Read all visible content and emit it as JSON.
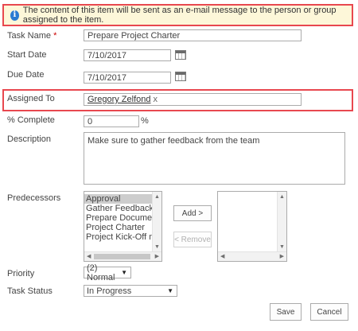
{
  "notice": {
    "text": "The content of this item will be sent as an e-mail message to the person or group assigned to the item.",
    "icon": "i"
  },
  "fields": {
    "task_name": {
      "label": "Task Name",
      "required_mark": "*",
      "value": "Prepare Project Charter"
    },
    "start_date": {
      "label": "Start Date",
      "value": "7/10/2017"
    },
    "due_date": {
      "label": "Due Date",
      "value": "7/10/2017"
    },
    "assigned_to": {
      "label": "Assigned To",
      "person": "Gregory Zelfond",
      "remove_mark": "x"
    },
    "percent_complete": {
      "label": "% Complete",
      "value": "0",
      "unit": "%"
    },
    "description": {
      "label": "Description",
      "value": "Make sure to gather feedback from the team"
    },
    "predecessors": {
      "label": "Predecessors",
      "available": [
        "Approval",
        "Gather Feedback",
        "Prepare Document",
        "Project Charter",
        "Project Kick-Off meet"
      ],
      "selected_index": 0,
      "add_label": "Add >",
      "remove_label": "< Remove"
    },
    "priority": {
      "label": "Priority",
      "value": "(2) Normal"
    },
    "task_status": {
      "label": "Task Status",
      "value": "In Progress"
    }
  },
  "actions": {
    "save": "Save",
    "cancel": "Cancel"
  },
  "colors": {
    "highlight_border": "#e8484f",
    "notice_bg": "#fdf7d9",
    "info_icon": "#2a7bd2"
  }
}
